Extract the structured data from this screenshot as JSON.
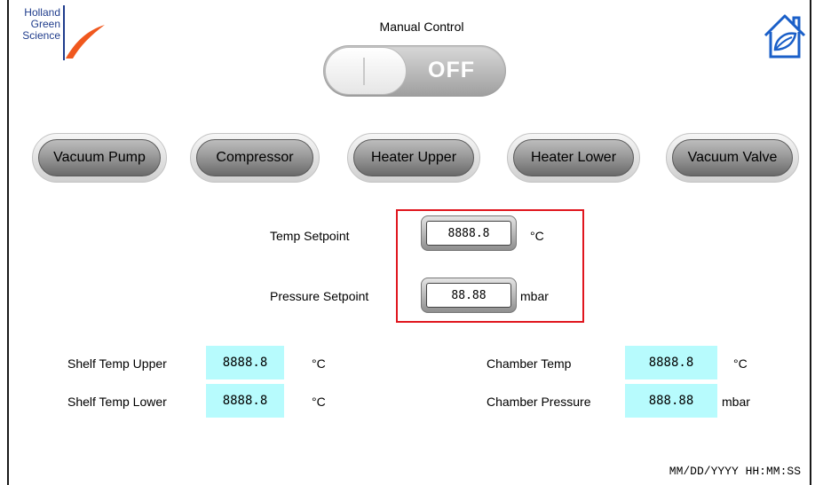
{
  "logo": {
    "line1": "Holland",
    "line2": "Green",
    "line3": "Science"
  },
  "header": {
    "title": "Manual Control",
    "toggle_state": "OFF",
    "home_icon": "home-leaf-icon"
  },
  "devices": [
    {
      "label": "Vacuum Pump"
    },
    {
      "label": "Compressor"
    },
    {
      "label": "Heater Upper"
    },
    {
      "label": "Heater Lower"
    },
    {
      "label": "Vacuum Valve"
    }
  ],
  "setpoints": {
    "temp": {
      "label": "Temp Setpoint",
      "value": "8888.8",
      "unit": "°C"
    },
    "pressure": {
      "label": "Pressure Setpoint",
      "value": "88.88",
      "unit": "mbar"
    }
  },
  "readouts": {
    "shelf_upper": {
      "label": "Shelf Temp Upper",
      "value": "8888.8",
      "unit": "°C"
    },
    "shelf_lower": {
      "label": "Shelf Temp Lower",
      "value": "8888.8",
      "unit": "°C"
    },
    "chamber_temp": {
      "label": "Chamber Temp",
      "value": "8888.8",
      "unit": "°C"
    },
    "chamber_pressure": {
      "label": "Chamber Pressure",
      "value": "888.88",
      "unit": "mbar"
    }
  },
  "footer": {
    "datetime": "MM/DD/YYYY HH:MM:SS"
  },
  "colors": {
    "brand_blue": "#1f3c8c",
    "brand_orange": "#f0581e",
    "readout_bg": "#b7fbfd",
    "highlight": "#e0161e",
    "home_blue": "#1a5fc8"
  }
}
